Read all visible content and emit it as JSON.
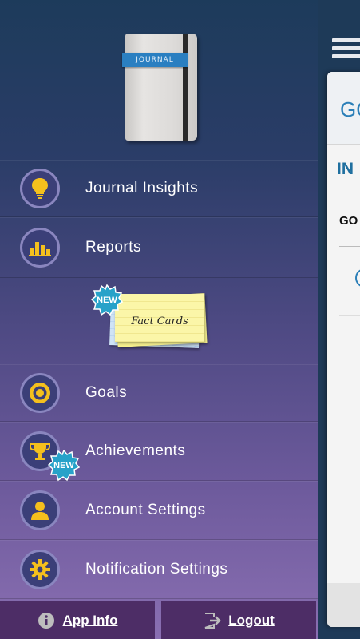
{
  "journal": {
    "label": "JOURNAL"
  },
  "menu": {
    "journal_insights": {
      "label": "Journal Insights",
      "icon": "lightbulb-icon"
    },
    "reports": {
      "label": "Reports",
      "icon": "bar-chart-icon"
    },
    "goals": {
      "label": "Goals",
      "icon": "target-icon"
    },
    "achievements": {
      "label": "Achievements",
      "icon": "trophy-icon"
    },
    "account_settings": {
      "label": "Account Settings",
      "icon": "person-icon"
    },
    "notification_settings": {
      "label": "Notification Settings",
      "icon": "gear-icon"
    }
  },
  "fact_cards": {
    "label": "Fact Cards",
    "badge": "NEW"
  },
  "achievements_badge": "NEW",
  "footer": {
    "app_info": "App Info",
    "logout": "Logout"
  },
  "right_panel": {
    "header": "GO",
    "section": "IN",
    "row": "GO"
  },
  "colors": {
    "icon_yellow": "#f5c01d",
    "badge_blue": "#27a2c9",
    "footer_purple": "#4d2d66",
    "accent_blue": "#2b7fb8"
  }
}
